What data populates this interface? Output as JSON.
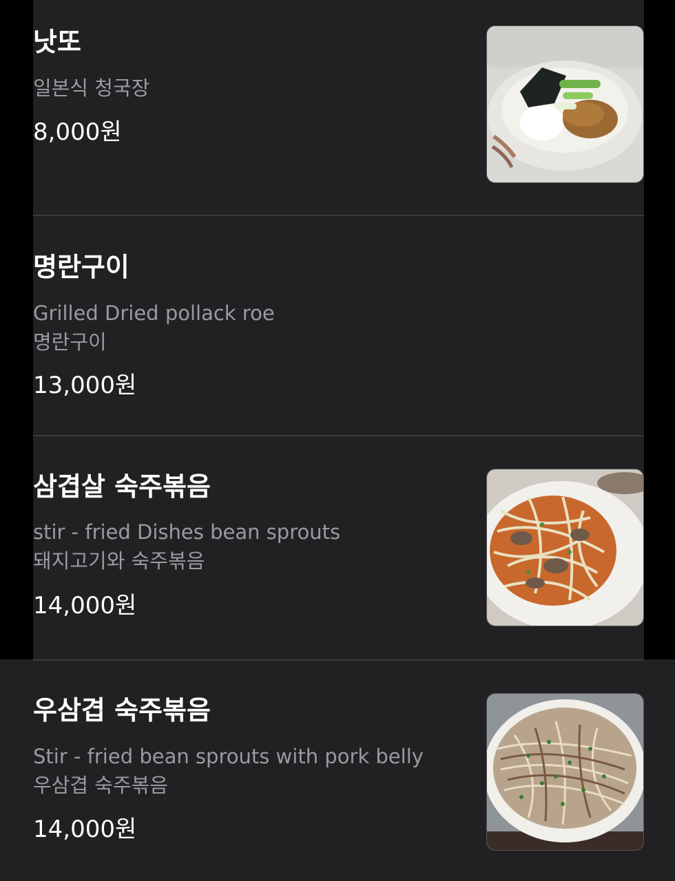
{
  "menu": {
    "items": [
      {
        "name": "낫또",
        "description": [
          "일본식 청국장"
        ],
        "price": "8,000원",
        "image": "natto-bowl-photo"
      },
      {
        "name": "명란구이",
        "description": [
          "Grilled Dried pollack roe",
          "명란구이"
        ],
        "price": "13,000원",
        "image": null
      },
      {
        "name": "삼겹살 숙주볶음",
        "description": [
          "stir - fried Dishes bean sprouts",
          "돼지고기와 숙주볶음"
        ],
        "price": "14,000원",
        "image": "pork-bean-sprouts-photo"
      },
      {
        "name": "우삼겹 숙주볶음",
        "description": [
          "Stir - fried bean sprouts with pork belly",
          "우삼겹 숙주볶음"
        ],
        "price": "14,000원",
        "image": "beef-brisket-bean-sprouts-photo"
      }
    ]
  },
  "colors": {
    "background": "#212123",
    "title": "#ffffff",
    "description": "#9a9aa0",
    "divider": "#3b3b3e"
  }
}
